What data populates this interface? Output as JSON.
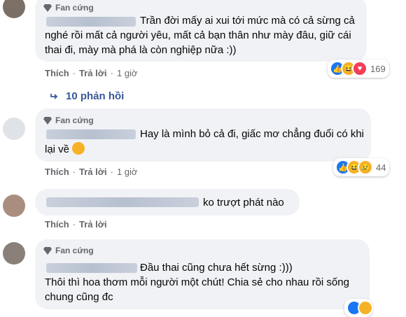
{
  "badge_label": "Fan cứng",
  "action_like": "Thích",
  "action_reply": "Trả lời",
  "comments": [
    {
      "lines": [
        "Trần đời mấy ai xui tới mức mà có cả sừng cả",
        "nghé rồi mất cả người yêu, mất cả bạn thân như mày đâu, giữ cái",
        "thai đi, mày mà phá là còn nghiệp nữa :))"
      ],
      "time": "1 giờ",
      "reactions": [
        "like-icon",
        "haha-icon",
        "love-icon"
      ],
      "reaction_count": "169"
    },
    {
      "lines": [
        "Hay là mình bỏ cả đi, giấc mơ chẳng đuổi có khi",
        "lại về"
      ],
      "emoji_after": "disappointed-face-icon",
      "time": "1 giờ",
      "reactions": [
        "like-icon",
        "haha-icon",
        "sad-icon"
      ],
      "reaction_count": "44"
    },
    {
      "lines": [
        "ko trượt phát nào"
      ],
      "time": ""
    },
    {
      "lines": [
        "Đầu thai cũng chưa hết sừng :)))",
        "Thôi thì hoa thơm mỗi người một chút! Chia sẻ cho nhau rồi sống",
        "chung cũng đc"
      ]
    }
  ],
  "replies_label": "10 phản hồi",
  "colors": {
    "bubble": "#f0f2f5",
    "link": "#385898",
    "like": "#1877f2",
    "love": "#f33e58",
    "haha": "#f7b125"
  }
}
